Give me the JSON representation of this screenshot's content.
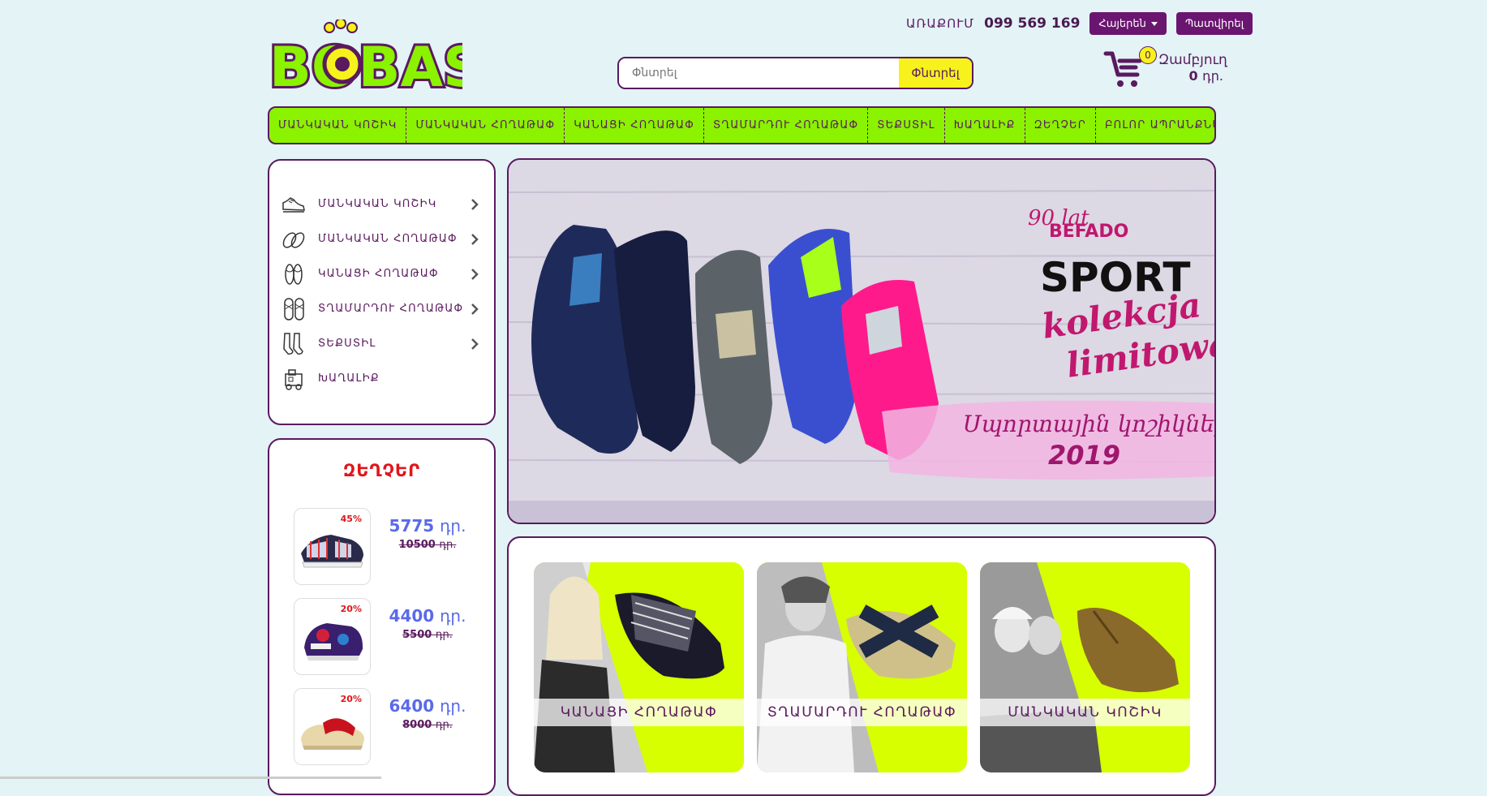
{
  "header": {
    "logo_text": "BOBAS",
    "phone_label": "ԱՌԱՔՈՒՄ",
    "phone": "099 569 169",
    "language_label": "Հայերեն",
    "order_button": "Պատվիրել",
    "search_placeholder": "Փնտրել",
    "search_button": "Փնտրել",
    "cart_count": "0",
    "cart_label": "Զամբյուղ",
    "cart_total": "0",
    "cart_currency": "դր."
  },
  "nav": {
    "items": [
      "ՄԱՆԿԱԿԱՆ ԿՈՇԻԿ",
      "ՄԱՆԿԱԿԱՆ ՀՈՂԱԹԱՓ",
      "ԿԱՆԱՑԻ ՀՈՂԱԹԱՓ",
      "ՏՂԱՄԱՐԴՈՒ ՀՈՂԱԹԱՓ",
      "ՏԵՔՍՏԻԼ",
      "ԽԱՂԱԼԻՔ",
      "ԶԵՂՉԵՐ",
      "ԲՈԼՈՐ ԱՊՐԱՆՔՆԵՐԸ"
    ]
  },
  "sidebar": {
    "categories": [
      {
        "label": "ՄԱՆԿԱԿԱՆ ԿՈՇԻԿ",
        "icon": "shoe-icon",
        "has_arrow": true
      },
      {
        "label": "ՄԱՆԿԱԿԱՆ ՀՈՂԱԹԱՓ",
        "icon": "kids-slipper-icon",
        "has_arrow": true
      },
      {
        "label": "ԿԱՆԱՑԻ ՀՈՂԱԹԱՓ",
        "icon": "women-slipper-icon",
        "has_arrow": true
      },
      {
        "label": "ՏՂԱՄԱՐԴՈՒ ՀՈՂԱԹԱՓ",
        "icon": "men-slipper-icon",
        "has_arrow": true
      },
      {
        "label": "ՏԵՔՍՏԻԼ",
        "icon": "socks-icon",
        "has_arrow": true
      },
      {
        "label": "ԽԱՂԱԼԻՔ",
        "icon": "toy-train-icon",
        "has_arrow": false
      }
    ],
    "deals_title": "ԶԵՂՉԵՐ",
    "deals": [
      {
        "discount": "45%",
        "price": "5775",
        "old_price": "10500",
        "currency": "դր."
      },
      {
        "discount": "20%",
        "price": "4400",
        "old_price": "5500",
        "currency": "դր."
      },
      {
        "discount": "20%",
        "price": "6400",
        "old_price": "8000",
        "currency": "դր."
      }
    ]
  },
  "banner": {
    "brand_script": "90 lat",
    "brand": "BEFADO",
    "headline": "SPORT",
    "subline1": "kolekcja",
    "subline2": "limitowan",
    "armenian_caption": "Սպորտային կոշիկներ",
    "year": "2019"
  },
  "cards": [
    {
      "label": "ԿԱՆԱՑԻ ՀՈՂԱԹԱՓ"
    },
    {
      "label": "ՏՂԱՄԱՐԴՈՒ ՀՈՂԱԹԱՓ"
    },
    {
      "label": "ՄԱՆԿԱԿԱՆ ԿՈՇԻԿ"
    }
  ],
  "colors": {
    "brand_purple": "#5a1a5e",
    "nav_green": "#8bf200",
    "accent_yellow": "#f7f21c",
    "sale_red": "#e0151b",
    "price_blue": "#5a6ae8"
  }
}
